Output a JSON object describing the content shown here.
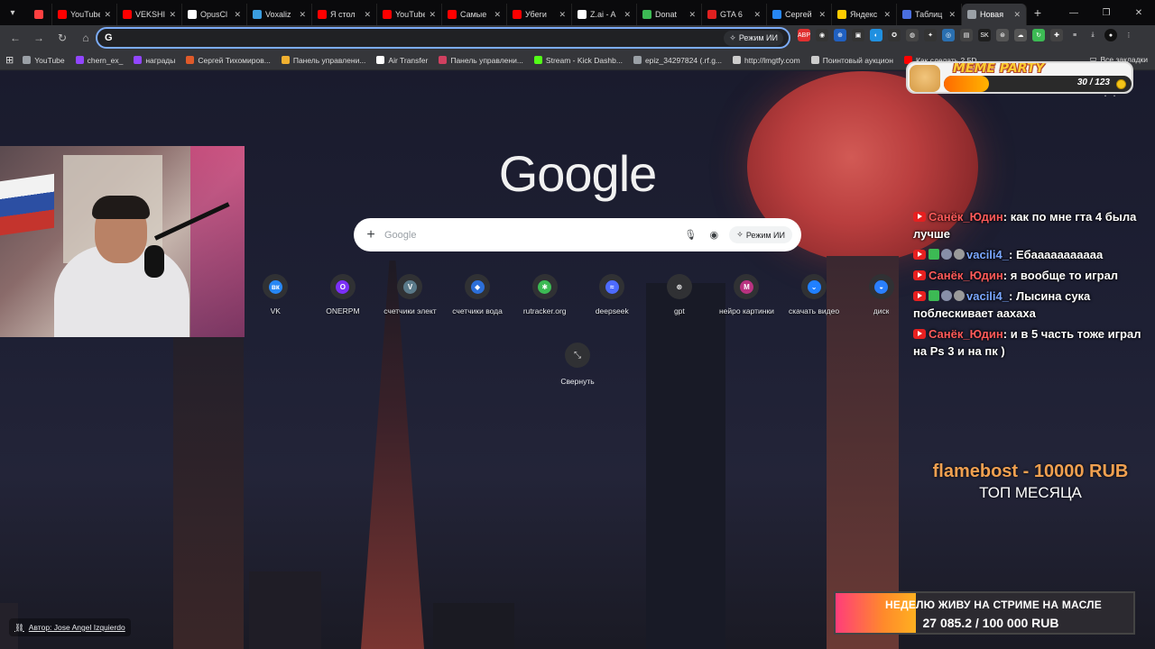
{
  "tabs": [
    {
      "label": "",
      "color": "#ff4040",
      "pinned": true
    },
    {
      "label": "YouTube",
      "color": "#ff0000"
    },
    {
      "label": "VEKSHI",
      "color": "#ff0000"
    },
    {
      "label": "OpusCl",
      "color": "#ffffff"
    },
    {
      "label": "Voxaliz",
      "color": "#3a9de0"
    },
    {
      "label": "Я стол",
      "color": "#ff0000"
    },
    {
      "label": "YouTube",
      "color": "#ff0000"
    },
    {
      "label": "Самые",
      "color": "#ff0000"
    },
    {
      "label": "Убеги",
      "color": "#ff0000"
    },
    {
      "label": "Z.ai - A",
      "color": "#ffffff"
    },
    {
      "label": "Donat",
      "color": "#3cba54"
    },
    {
      "label": "GTA 6",
      "color": "#e02020"
    },
    {
      "label": "Сергей",
      "color": "#2787f5"
    },
    {
      "label": "Яндекс",
      "color": "#ffcc00"
    },
    {
      "label": "Таблиц",
      "color": "#4a6fe0"
    },
    {
      "label": "Новая",
      "color": "#9aa0a6",
      "active": true
    }
  ],
  "omnibox": {
    "value": "",
    "ai_mode": "Режим ИИ"
  },
  "bookmarks": [
    {
      "label": "YouTube",
      "color": "#9aa0a6"
    },
    {
      "label": "chern_ex_",
      "color": "#9146ff"
    },
    {
      "label": "награды",
      "color": "#9146ff"
    },
    {
      "label": "Сергей Тихомиров...",
      "color": "#e05a2a"
    },
    {
      "label": "Панель управлени...",
      "color": "#f0b030"
    },
    {
      "label": "Air Transfer",
      "color": "#ffffff"
    },
    {
      "label": "Панель управлени...",
      "color": "#d04060"
    },
    {
      "label": "Stream - Kick Dashb...",
      "color": "#53fc18"
    },
    {
      "label": "epiz_34297824 (.rf.g...",
      "color": "#9aa0a6"
    },
    {
      "label": "http://lmgtfy.com",
      "color": "#cccccc"
    },
    {
      "label": "Поинтовый аукцион",
      "color": "#cccccc"
    },
    {
      "label": "Как сделать 2.5D",
      "color": "#ff0000"
    }
  ],
  "bookmarks_all": "Все закладки",
  "google": {
    "logo": "Google",
    "search_placeholder": "Google",
    "ai_mode": "Режим ИИ",
    "shortcuts": [
      {
        "label": "VK",
        "glyph": "вк",
        "color": "#2787f5"
      },
      {
        "label": "ONERPM",
        "glyph": "O",
        "color": "#7b2ff7"
      },
      {
        "label": "счетчики элект",
        "glyph": "V",
        "color": "#5a7a8a"
      },
      {
        "label": "счетчики вода",
        "glyph": "◆",
        "color": "#2c6fd8"
      },
      {
        "label": "rutracker.org",
        "glyph": "✱",
        "color": "#3cba54"
      },
      {
        "label": "deepseek",
        "glyph": "≈",
        "color": "#4d6bfe"
      },
      {
        "label": "gpt",
        "glyph": "⊛",
        "color": "#303134"
      },
      {
        "label": "нейро картинки",
        "glyph": "M",
        "color": "#b83280"
      },
      {
        "label": "скачать видео",
        "glyph": "⌄",
        "color": "#2080ff"
      },
      {
        "label": "диск",
        "glyph": "◒",
        "color": "#2a7fff"
      }
    ],
    "collapse_label": "Свернуть",
    "author": "Автор: Jose Angel Izquierdo"
  },
  "overlay": {
    "meme_title": "MEME PARTY",
    "meme_count": "30 / 123",
    "meme_progress": 0.24,
    "chat": [
      {
        "user": "Санёк_Юдин",
        "user_class": "u-red",
        "badges": [
          "yt"
        ],
        "text": "как по мне гта 4 была лучше"
      },
      {
        "user": "vacili4_",
        "user_class": "u-blue",
        "badges": [
          "yt",
          "green",
          "w",
          "gray"
        ],
        "text": "Ебааааааааааа"
      },
      {
        "user": "Санёк_Юдин",
        "user_class": "u-red",
        "badges": [
          "yt"
        ],
        "text": "я вообще то играл"
      },
      {
        "user": "vacili4_",
        "user_class": "u-blue",
        "badges": [
          "yt",
          "green",
          "w",
          "gray"
        ],
        "text": "Лысина сука поблескивает аахаха"
      },
      {
        "user": "Санёк_Юдин",
        "user_class": "u-red",
        "badges": [
          "yt"
        ],
        "text": "и в 5 часть тоже играл на Ps 3  и на пк )"
      }
    ],
    "top_donor": "flamebost - 10000 RUB",
    "top_label": "ТОП МЕСЯЦА",
    "goal_title": "НЕДЕЛЮ ЖИВУ НА СТРИМЕ НА МАСЛЕ",
    "goal_value": "27 085.2 / 100 000 RUB",
    "goal_progress": 0.27
  }
}
